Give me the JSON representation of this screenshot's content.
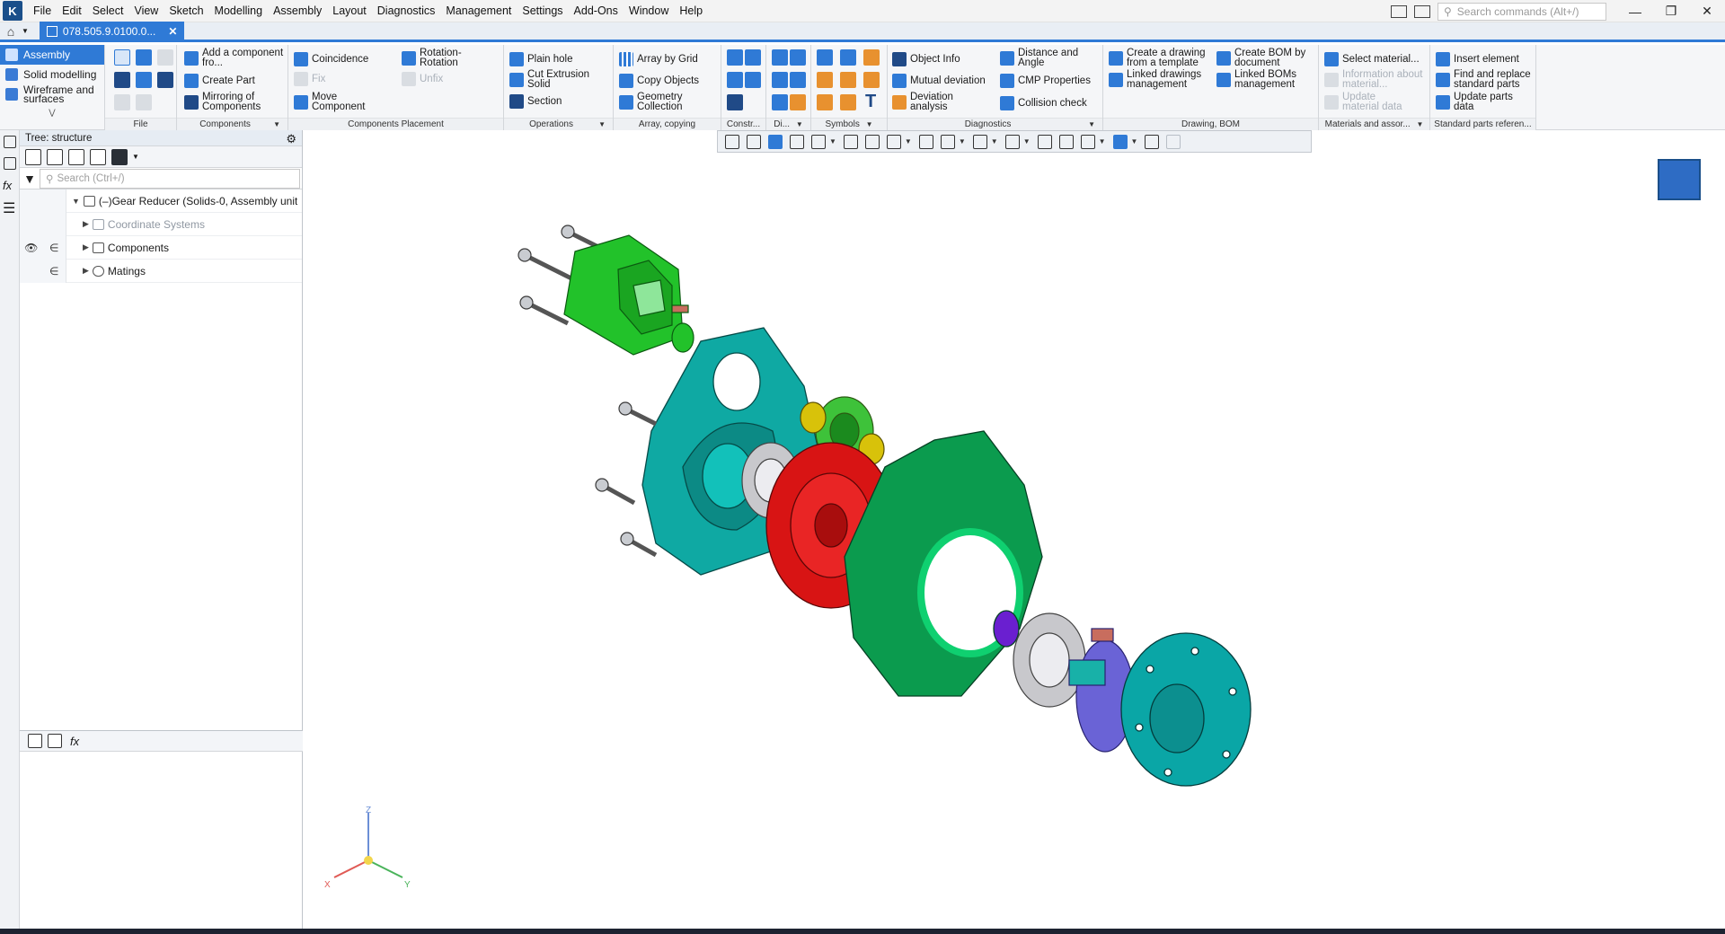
{
  "menu": {
    "items": [
      "File",
      "Edit",
      "Select",
      "View",
      "Sketch",
      "Modelling",
      "Assembly",
      "Layout",
      "Diagnostics",
      "Management",
      "Settings",
      "Add-Ons",
      "Window",
      "Help"
    ],
    "search_placeholder": "Search commands (Alt+/)"
  },
  "tab": {
    "doc_title": "078.505.9.0100.0..."
  },
  "ribbon": {
    "modes": {
      "assembly": "Assembly",
      "solid": "Solid modelling",
      "wireframe": "Wireframe and surfaces"
    },
    "groups": {
      "file": "File",
      "components": "Components",
      "placement": "Components Placement",
      "operations": "Operations",
      "array": "Array, copying",
      "constr": "Constr...",
      "di": "Di...",
      "symbols": "Symbols",
      "diagnostics": "Diagnostics",
      "drawing": "Drawing, BOM",
      "materials": "Materials and assor...",
      "standard": "Standard parts referen..."
    },
    "buttons": {
      "add_component": "Add a component fro...",
      "create_part": "Create Part",
      "mirroring": "Mirroring of Components",
      "coincidence": "Coincidence",
      "fix": "Fix",
      "move_component": "Move Component",
      "rotation": "Rotation-Rotation",
      "unfix": "Unfix",
      "plain_hole": "Plain hole",
      "cut_extrusion": "Cut Extrusion Solid",
      "section": "Section",
      "array_grid": "Array by Grid",
      "copy_objects": "Copy Objects",
      "geometry_collection": "Geometry Collection",
      "object_info": "Object Info",
      "mutual_deviation": "Mutual deviation",
      "deviation_analysis": "Deviation analysis",
      "distance_angle": "Distance and Angle",
      "cmp_properties": "CMP Properties",
      "collision_check": "Collision check",
      "create_drawing": "Create a drawing from a template",
      "linked_drawings": "Linked drawings management",
      "create_bom": "Create BOM by document",
      "linked_boms": "Linked BOMs management",
      "select_material": "Select material...",
      "info_material": "Information about material...",
      "update_material": "Update material data",
      "insert_element": "Insert element",
      "find_replace": "Find and replace standard parts",
      "update_parts": "Update parts data"
    }
  },
  "tree": {
    "title": "Tree: structure",
    "search_placeholder": "Search (Ctrl+/)",
    "root": "(–)Gear Reducer (Solids-0, Assembly unit",
    "coord_systems": "Coordinate Systems",
    "components": "Components",
    "matings": "Matings",
    "membership_symbol": "∈"
  },
  "triad": {
    "z": "Z",
    "x": "X",
    "y": "Y"
  },
  "colors": {
    "accent": "#2f7ad6",
    "motor_green": "#22c22a",
    "housing_teal": "#0fa9a3",
    "housing_green": "#0b9b4e",
    "gear_red": "#d81414",
    "flange_teal": "#0aa6a6",
    "coupling_purple": "#6a63d6",
    "ring_yellow": "#d8c20a"
  }
}
